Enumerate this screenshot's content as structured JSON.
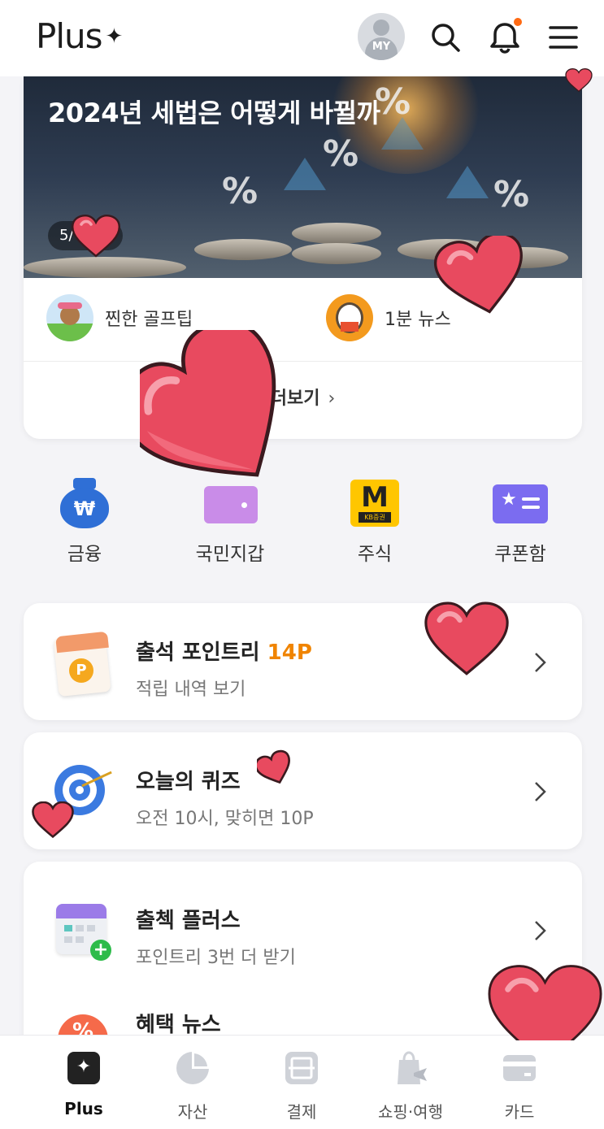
{
  "header": {
    "logo_text": "Plus",
    "logo_mark": "✦",
    "avatar_label": "MY",
    "icons": [
      "search-icon",
      "bell-icon",
      "menu-icon"
    ],
    "notification_dot_color": "#ff6a13"
  },
  "feature": {
    "banner_title": "2024년 세법은 어떻게 바뀔까",
    "page_counter": "5/",
    "items": [
      {
        "label": "찐한 골프팁"
      },
      {
        "label": "1분 뉴스"
      }
    ],
    "more_label": "더보기",
    "more_chevron": "›"
  },
  "quick_menu": [
    {
      "label": "금융",
      "icon": "money-bag-icon"
    },
    {
      "label": "국민지갑",
      "icon": "wallet-icon"
    },
    {
      "label": "주식",
      "icon": "kb-stock-icon",
      "badge_letter": "M",
      "badge_sub": "KB증권"
    },
    {
      "label": "쿠폰함",
      "icon": "coupon-icon"
    }
  ],
  "cards": {
    "attendance": {
      "title": "출석 포인트리",
      "points": "14P",
      "subtitle": "적립 내역 보기"
    },
    "quiz": {
      "title": "오늘의 퀴즈",
      "subtitle": "오전 10시, 맞히면 10P"
    },
    "checkin": {
      "title": "출첵 플러스",
      "subtitle": "포인트리 3번 더 받기"
    },
    "benefit": {
      "title": "혜택 뉴스"
    }
  },
  "tabbar": [
    {
      "label": "Plus",
      "active": true
    },
    {
      "label": "자산",
      "active": false
    },
    {
      "label": "결제",
      "active": false
    },
    {
      "label": "쇼핑·여행",
      "active": false
    },
    {
      "label": "카드",
      "active": false
    }
  ],
  "colors": {
    "accent_orange": "#f08400",
    "heart_red": "#e84a5f",
    "money_blue": "#2f6fd6",
    "wallet_purple": "#c98ce8",
    "kb_yellow": "#ffc600",
    "coupon_purple": "#7b6cf0"
  }
}
